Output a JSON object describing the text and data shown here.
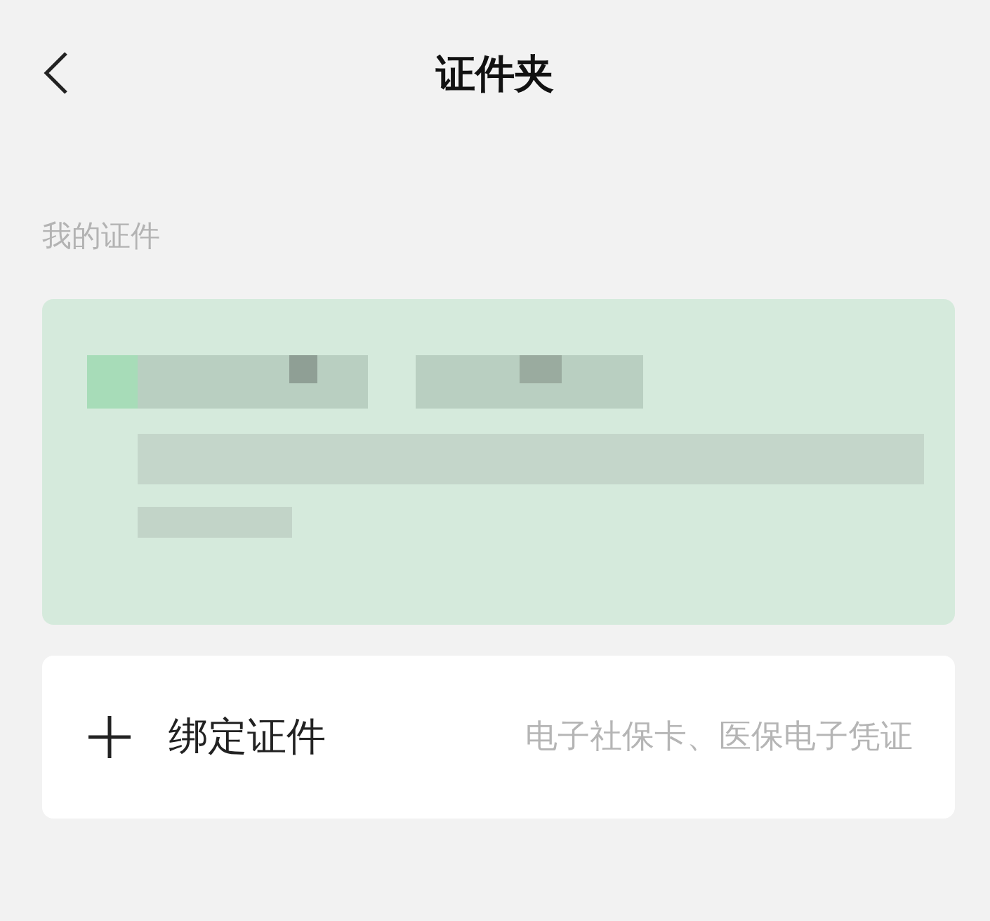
{
  "header": {
    "title": "证件夹"
  },
  "section_label": "我的证件",
  "bind_row": {
    "label": "绑定证件",
    "hint": "电子社保卡、医保电子凭证"
  }
}
